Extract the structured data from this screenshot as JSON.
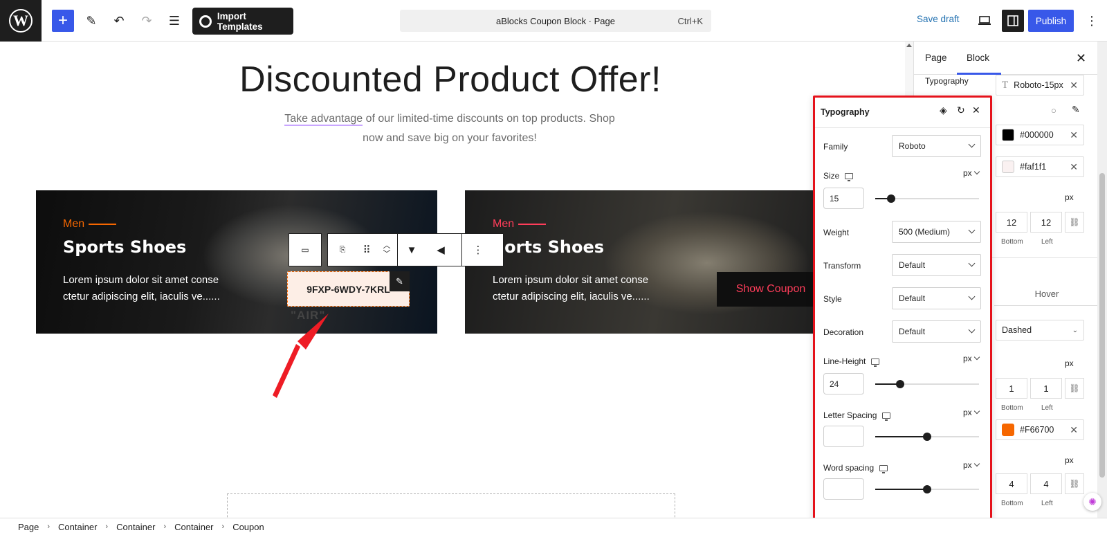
{
  "topbar": {
    "import_label": "Import Templates",
    "command_title": "aBlocks Coupon Block · Page",
    "command_shortcut": "Ctrl+K",
    "save_draft": "Save draft",
    "publish": "Publish"
  },
  "canvas": {
    "heading": "Discounted Product Offer!",
    "subtext_link": "Take advantage",
    "subtext_rest": " of our limited-time discounts on top products. Shop now and save big on your favorites!",
    "cards": [
      {
        "category": "Men",
        "title": "Sports Shoes",
        "description": "Lorem ipsum dolor sit amet conse ctetur adipiscing elit, iaculis ve......",
        "coupon_code": "9FXP-6WDY-7KRL",
        "overlay_text": "\"AIR\""
      },
      {
        "category": "Men",
        "title": "ports Shoes",
        "description": "Lorem ipsum dolor sit amet conse ctetur adipiscing elit, iaculis ve......",
        "button": "Show Coupon"
      }
    ]
  },
  "sidebar": {
    "tabs": [
      "Page",
      "Block"
    ],
    "active_tab": "Block",
    "typography_label": "Typography",
    "typography_value": "Roboto-15px",
    "color_1": "#000000",
    "color_2": "#faf1f1",
    "unit_1": "px",
    "padding_bottom": "12",
    "padding_left": "12",
    "bottom_label": "Bottom",
    "left_label": "Left",
    "hover_tab": "Hover",
    "border_style": "Dashed",
    "unit_2": "px",
    "border_bottom": "1",
    "border_left": "1",
    "border_color": "#F66700",
    "unit_3": "px",
    "radius_bottom": "4",
    "radius_left": "4"
  },
  "popover": {
    "title": "Typography",
    "family_label": "Family",
    "family_value": "Roboto",
    "size_label": "Size",
    "size_unit": "px",
    "size_value": "15",
    "size_slider": 0.15,
    "weight_label": "Weight",
    "weight_value": "500 (Medium)",
    "transform_label": "Transform",
    "transform_value": "Default",
    "style_label": "Style",
    "style_value": "Default",
    "decoration_label": "Decoration",
    "decoration_value": "Default",
    "line_height_label": "Line-Height",
    "line_height_unit": "px",
    "line_height_value": "24",
    "line_height_slider": 0.24,
    "letter_spacing_label": "Letter Spacing",
    "letter_spacing_unit": "px",
    "letter_spacing_value": "",
    "letter_spacing_slider": 0.5,
    "word_spacing_label": "Word spacing",
    "word_spacing_unit": "px",
    "word_spacing_value": "",
    "word_spacing_slider": 0.5
  },
  "breadcrumb": [
    "Page",
    "Container",
    "Container",
    "Container",
    "Coupon"
  ],
  "colors": {
    "accent": "#3858e9",
    "highlight_border": "#e5121b",
    "category_orange": "#f66700",
    "category_pink": "#ff3d5a"
  }
}
